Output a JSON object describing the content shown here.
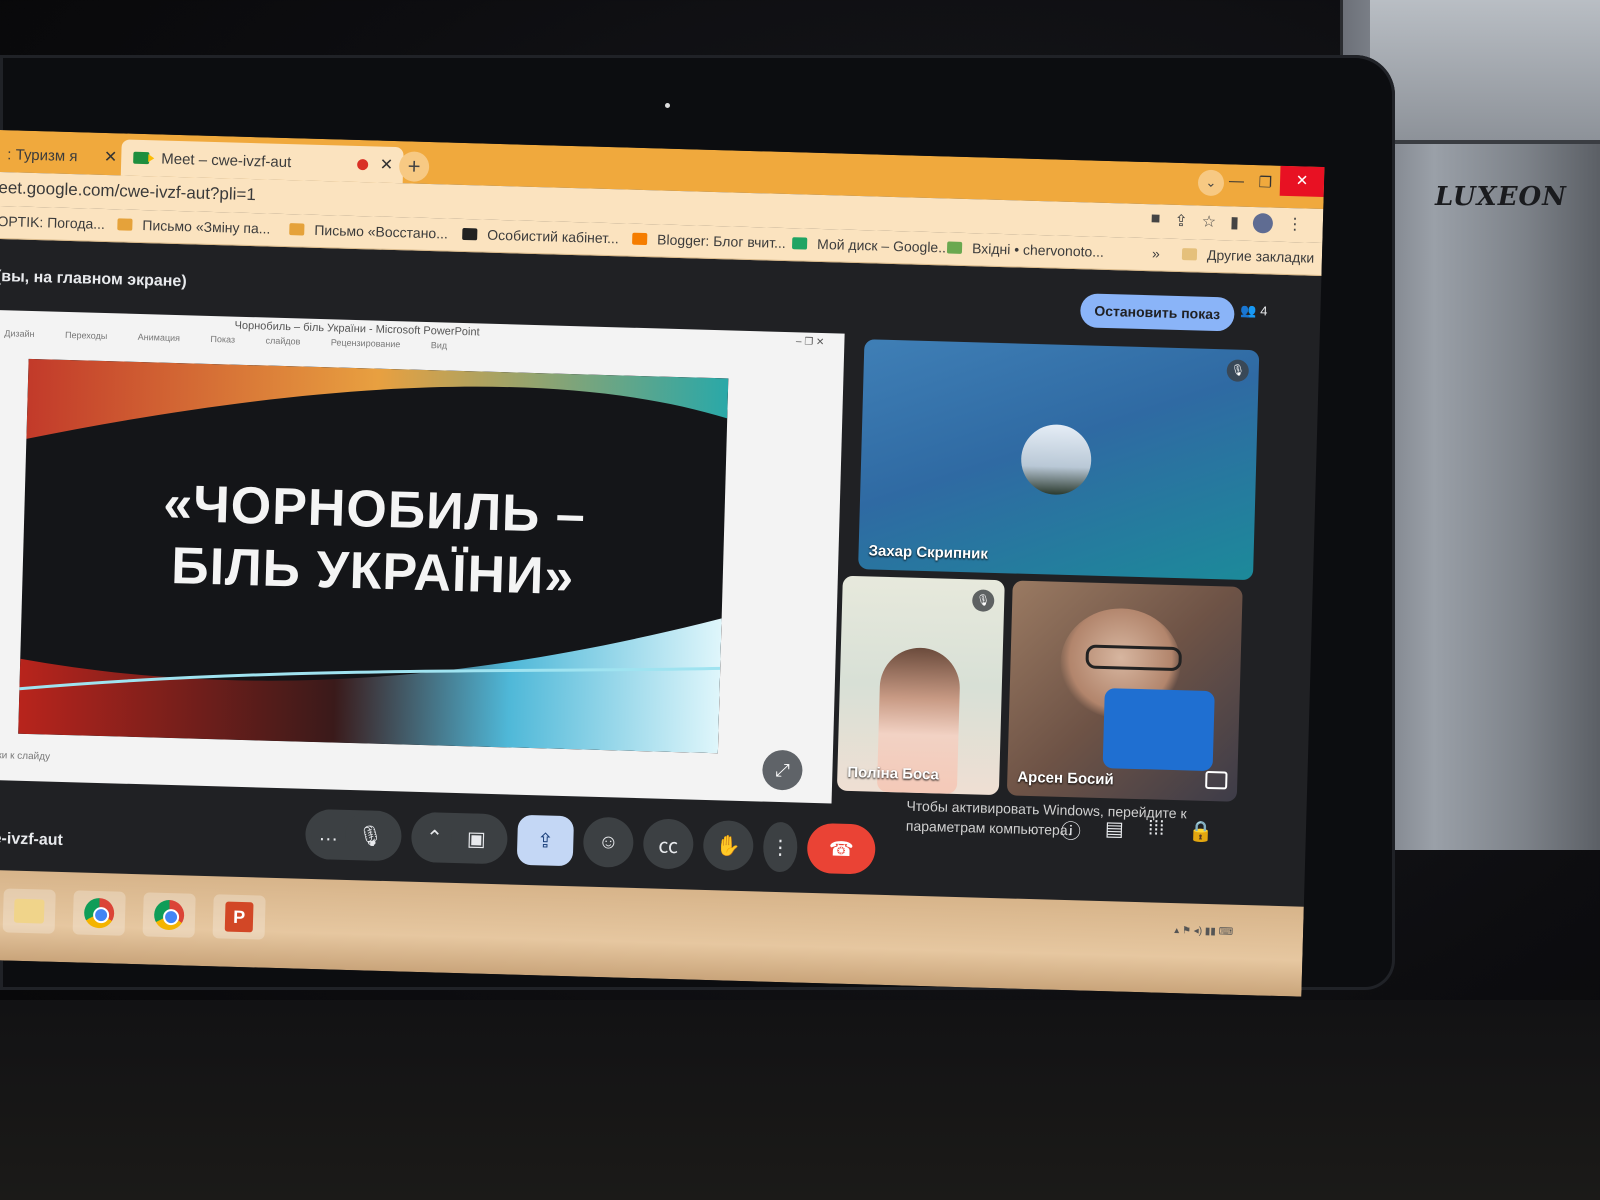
{
  "tabs": [
    {
      "label": ": Туризм я",
      "active": false
    },
    {
      "label": "Meet – cwe-ivzf-aut",
      "active": true
    }
  ],
  "address": {
    "url": "eet.google.com/cwe-ivzf-aut?pli=1"
  },
  "bookmarks": [
    {
      "label": "OPTIK: Погода...",
      "color": "#4a90d9"
    },
    {
      "label": "Письмо «Зміну па...",
      "color": "#e5a23a"
    },
    {
      "label": "Письмо «Восстано...",
      "color": "#e5a23a"
    },
    {
      "label": "Особистий кабінет...",
      "color": "#222222"
    },
    {
      "label": "Blogger: Блог вчит...",
      "color": "#f57d00"
    },
    {
      "label": "Мой диск – Google...",
      "color": "#1fa463"
    },
    {
      "label": "Вхідні • chervonoto...",
      "color": "#6aa84f"
    },
    {
      "label": "»",
      "color": ""
    },
    {
      "label": "Другие закладки",
      "color": "#e5c07b"
    }
  ],
  "meet": {
    "presenting_label": "(вы, на главном экране)",
    "stop_button": "Остановить показ",
    "people_count": "4",
    "meeting_code": "we-ivzf-aut"
  },
  "slide_window": {
    "title": "Чорнобиль – біль України - Microsoft PowerPoint",
    "ribbon": "Дизайн Переходы Анимация Показ слайдов Рецензирование Вид",
    "slide_title_line1": "«ЧОРНОБИЛЬ –",
    "slide_title_line2": "БІЛЬ УКРАЇНИ»",
    "notes_hint": "етки к слайду"
  },
  "participants": [
    {
      "name": "Захар Скрипник",
      "muted": true
    },
    {
      "name": "Поліна Боса",
      "muted": true
    },
    {
      "name": "Арсен Босий",
      "muted": false
    }
  ],
  "windows_notice": {
    "line1": "Чтобы активировать Windows, перейдите к",
    "line2": "параметрам компьютера."
  },
  "device": {
    "brand": "LUXEON"
  },
  "colors": {
    "accent": "#8ab4f8",
    "end_call": "#ea4335",
    "tabbar": "#f0a93d"
  }
}
